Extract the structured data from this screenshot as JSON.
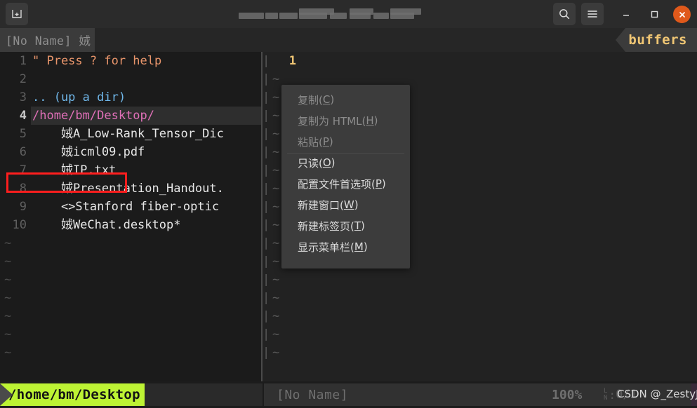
{
  "titlebar": {
    "new_tab_icon": "new-tab-icon",
    "search_icon": "search-icon",
    "hamburger_icon": "hamburger-menu-icon",
    "minimize_label": "—",
    "maximize_label": "□",
    "close_label": "✕",
    "title_text": "",
    "close_color": "#e0591b"
  },
  "vim": {
    "tabline": {
      "tab_label": "[No Name] 娀",
      "buffers_label": "buffers",
      "buffers_color": "#f0c674"
    },
    "left_pane": {
      "lines": [
        {
          "num": "1",
          "text": "\" Press ? for help",
          "color": "#e8956b",
          "current": false
        },
        {
          "num": "2",
          "text": "",
          "color": "#cccccc",
          "current": false
        },
        {
          "num": "3",
          "text": ".. (up a dir)",
          "color": "#6fb6e8",
          "current": false
        },
        {
          "num": "4",
          "text": "/home/bm/Desktop/",
          "color": "#e070b8",
          "current": true
        },
        {
          "num": "5",
          "text": "    娀A_Low-Rank_Tensor_Dic",
          "color": "#e6e6e6",
          "current": false
        },
        {
          "num": "6",
          "text": "    娀icml09.pdf",
          "color": "#e6e6e6",
          "current": false
        },
        {
          "num": "7",
          "text": "    娀IP.txt",
          "color": "#e6e6e6",
          "current": false
        },
        {
          "num": "8",
          "text": "    娀Presentation_Handout.",
          "color": "#e6e6e6",
          "current": false
        },
        {
          "num": "9",
          "text": "    <>Stanford fiber-optic",
          "color": "#e6e6e6",
          "current": false
        },
        {
          "num": "10",
          "text": "    娀WeChat.desktop*",
          "color": "#e6e6e6",
          "current": false
        }
      ],
      "empty_marker": "~",
      "empty_rows": 7
    },
    "right_pane": {
      "first_line_number": "1",
      "empty_marker": "~",
      "empty_rows": 16
    }
  },
  "statusline": {
    "mode_path": "/home/bm/Desktop",
    "mode_bg": "#bdf334",
    "buffer_name": "[No Name]",
    "zoom_level": "100%",
    "line_label_top": "L",
    "line_label_bottom": "N",
    "line_value": "0/1"
  },
  "context_menu": {
    "items": [
      {
        "label": "复制(C)",
        "mnemonic": "C",
        "disabled": true,
        "name": "menu-item-copy"
      },
      {
        "label": "复制为 HTML(H)",
        "mnemonic": "H",
        "disabled": true,
        "name": "menu-item-copy-as-html"
      },
      {
        "label": "粘贴(P)",
        "mnemonic": "P",
        "disabled": true,
        "name": "menu-item-paste"
      },
      {
        "label": "只读(O)",
        "mnemonic": "O",
        "disabled": false,
        "name": "menu-item-read-only"
      },
      {
        "label": "配置文件首选项(P)",
        "mnemonic": "P",
        "disabled": false,
        "name": "menu-item-profile-preferences"
      },
      {
        "label": "新建窗口(W)",
        "mnemonic": "W",
        "disabled": false,
        "name": "menu-item-new-window"
      },
      {
        "label": "新建标签页(T)",
        "mnemonic": "T",
        "disabled": false,
        "name": "menu-item-new-tab"
      },
      {
        "label": "显示菜单栏(M)",
        "mnemonic": "M",
        "disabled": false,
        "name": "menu-item-show-menubar"
      }
    ],
    "highlight_index": 4,
    "highlight_color": "#ff1e1e"
  },
  "watermark": {
    "text": "CSDN @_ZestyJt"
  }
}
